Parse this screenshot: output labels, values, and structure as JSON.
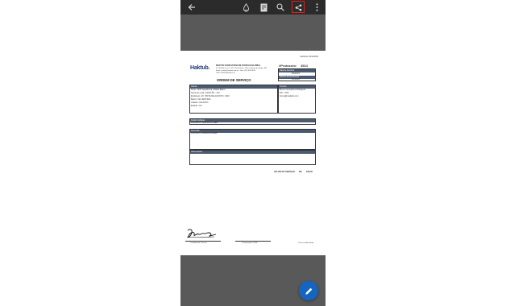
{
  "toolbar": {
    "back_icon": "arrow-left-icon",
    "ink_icon": "ink-drop-icon",
    "page_mode_icon": "document-page-icon",
    "search_icon": "search-icon",
    "share_icon": "share-icon",
    "more_icon": "more-vertical-icon"
  },
  "document": {
    "date_line": "Jacobina, 06/11/2019",
    "company_logo": "Haktub.",
    "company_name": "MAKTUB CONSULTORIA EM TECNOLOGIA EIRELI",
    "company_address": "R. Cândido Lúcio, nº 471, Santo Pedro - São Cristóvão de Itajubá - MG",
    "company_contact": "Email: contato@maktub.com.br - Fone: (35) 3623-3024",
    "company_cnpj": "CNPJ 28.483.885/0001-21",
    "protocol_label": "#Protocolo:",
    "protocol_number": "4514",
    "title": "ORDEM DE SERVIÇO",
    "opening_label": "Data de Abertura",
    "opening_date": "06/11/19",
    "closing_label": "Data de Encerramento",
    "closing_date": "11/11/19",
    "client_label": "Cliente",
    "client_lines": [
      "Nível: 1320        Aguabrava Cidade Bairro",
      "Nome de Loja: CATALÃO - GO",
      "Endereço: AV. VINTE DE AGOSTO, 1320",
      "Bairro: CE CENTRAL",
      "Cidade: CATALÃO",
      "Estado: GO"
    ],
    "technician_label": "Técnico",
    "technician_lines": [
      "Bruno Gonçalves Rodrigues",
      "RG - CPF",
      "bruno@maktub.com"
    ],
    "request_label": "Pedido Software",
    "request_value": "PROJETO ORBISLOG-WEB",
    "description_label": "Descrição",
    "description_value": "PROJETO ORBISLOGWEB",
    "notes_label": "Observações",
    "service_value_label": "VALOR DO SERVIÇO",
    "currency": "R$",
    "service_value": "180,00",
    "signature_left": "Coordenador Técnico",
    "signature_middle": "Coordenador SOSE",
    "signature_right": "Visto com Anuidade"
  },
  "fab": {
    "icon": "pencil-edit-icon"
  },
  "colors": {
    "topbar": "#2b2b2b",
    "viewer_bg": "#595959",
    "fab": "#1565c0",
    "highlight": "#e0201c",
    "box_header": "#4a5a70"
  }
}
